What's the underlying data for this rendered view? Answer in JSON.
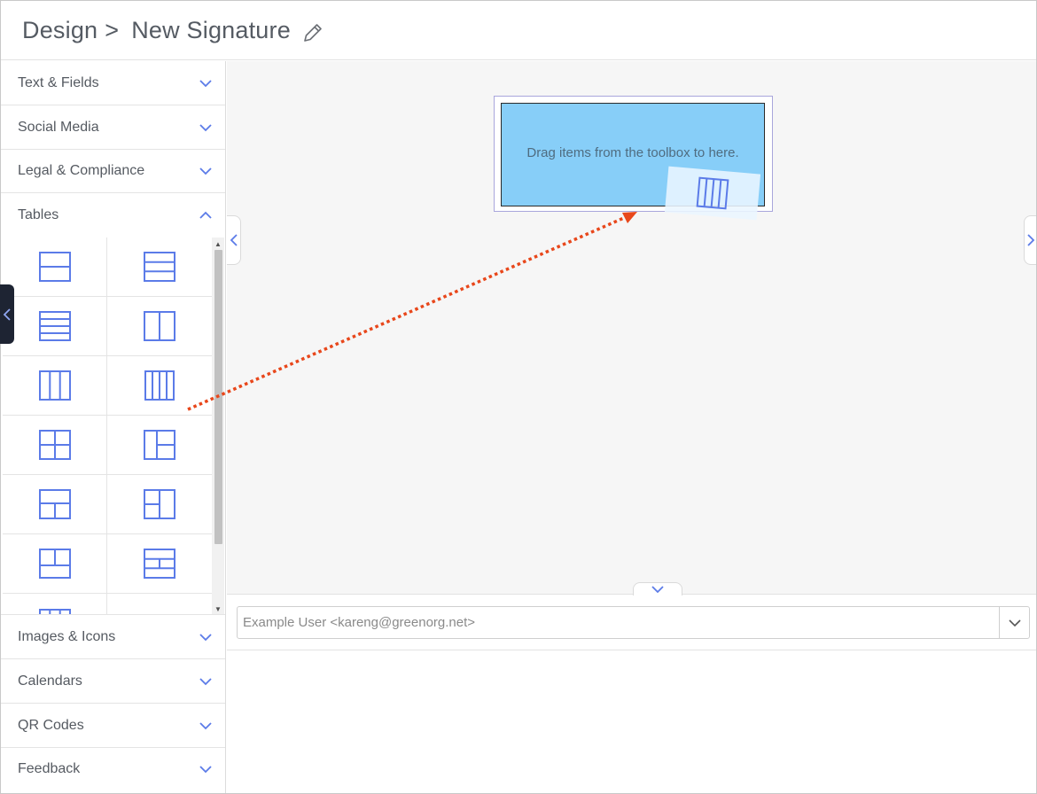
{
  "header": {
    "breadcrumb_root": "Design",
    "breadcrumb_separator": ">",
    "signature_name": "New Signature",
    "edit_icon": "pencil-icon"
  },
  "sidebar": {
    "sections_top": [
      {
        "label": "Text & Fields",
        "state": "collapsed"
      },
      {
        "label": "Social Media",
        "state": "collapsed"
      },
      {
        "label": "Legal & Compliance",
        "state": "collapsed"
      },
      {
        "label": "Tables",
        "state": "expanded"
      }
    ],
    "tables_items": [
      "table-2-rows-icon",
      "table-3-rows-icon",
      "table-4-rows-icon",
      "table-2-columns-icon",
      "table-3-columns-icon",
      "table-4-columns-icon",
      "table-2x2-grid-icon",
      "table-1-column-2-rows-icon",
      "table-1-row-2-columns-icon",
      "table-2-rows-1-column-icon",
      "table-2-columns-1-row-icon",
      "table-3-rows-split-icon"
    ],
    "sections_bottom": [
      {
        "label": "Images & Icons",
        "state": "collapsed"
      },
      {
        "label": "Calendars",
        "state": "collapsed"
      },
      {
        "label": "QR Codes",
        "state": "collapsed"
      },
      {
        "label": "Feedback",
        "state": "collapsed"
      }
    ]
  },
  "canvas": {
    "drop_zone_text": "Drag items from the toolbox to here.",
    "drag_item": "table-4-columns-icon"
  },
  "preview": {
    "user_select_value": "Example User <kareng@greenorg.net>"
  },
  "colors": {
    "accent": "#5b7be8",
    "drop_zone": "#87cef8",
    "drag_arrow": "#e8471b",
    "sidebar_tab": "#1e2433"
  }
}
